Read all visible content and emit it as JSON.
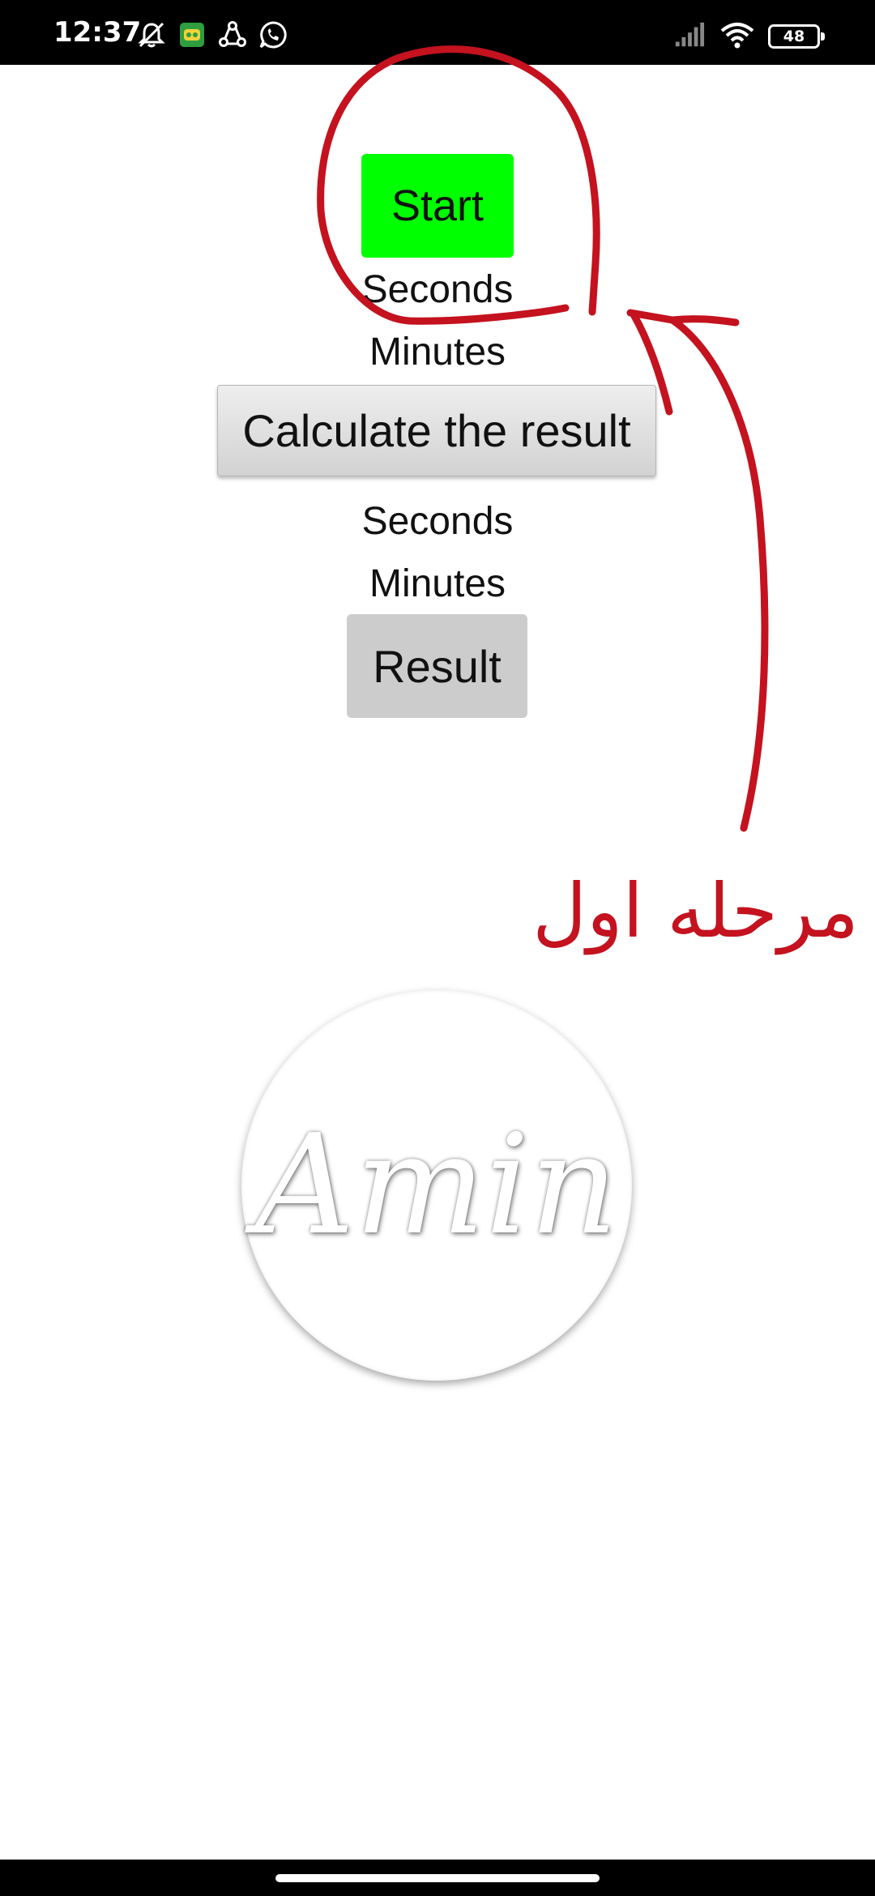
{
  "status_bar": {
    "time": "12:37",
    "battery_level": "48",
    "icons": [
      "bell-off-icon",
      "game-app-icon",
      "share-app-icon",
      "whatsapp-icon",
      "signal-icon",
      "wifi-icon",
      "battery-icon"
    ]
  },
  "app": {
    "start_label": "Start",
    "seconds_label_1": "Seconds",
    "minutes_label_1": "Minutes",
    "calculate_label": "Calculate the result",
    "seconds_label_2": "Seconds",
    "minutes_label_2": "Minutes",
    "result_label": "Result",
    "start_color": "#00ff00",
    "result_color": "#cccccc"
  },
  "annotation": {
    "text": "مرحله اول",
    "color": "#c4121f"
  },
  "logo": {
    "text": "Amin"
  }
}
